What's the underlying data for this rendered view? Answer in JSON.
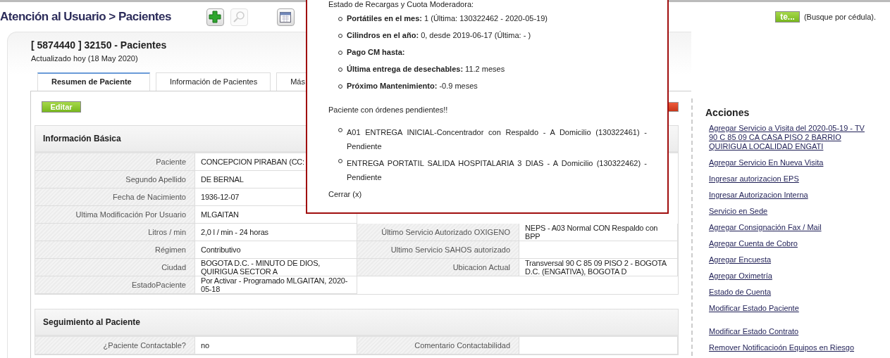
{
  "header": {
    "title": "Atención al Usuario > Pacientes",
    "toolbar": [
      {
        "kind": "add",
        "disabled": false
      },
      {
        "kind": "search",
        "disabled": true
      },
      {
        "kind": "calendar",
        "disabled": false
      }
    ],
    "search_button": "te...",
    "search_hint": "(Busque por cédula)."
  },
  "record": {
    "title": "[ 5874440 ] 32150 - Pacientes",
    "subtitle": "Actualizado hoy (18 May 2020)",
    "tabs": [
      {
        "label": "Resumen de Paciente",
        "selected": true
      },
      {
        "label": "Información de Pacientes",
        "selected": false
      },
      {
        "label": "Más",
        "selected": false
      }
    ],
    "edit_button": "Editar",
    "sections": [
      {
        "title": "Información Básica",
        "rows": [
          {
            "label": "Paciente",
            "value": "CONCEPCION PIRABAN (CC:"
          },
          {
            "label": "Segundo Apellido",
            "value": "DE BERNAL"
          },
          {
            "label": "Fecha de Nacimiento",
            "value": "1936-12-07"
          },
          {
            "label": "Ultima Modificación Por Usuario",
            "value": "MLGAITAN"
          },
          {
            "label": "Litros / min",
            "value": "2,0 l / min - 24 horas",
            "label_2": "Último Servicio Autorizado OXIGENO",
            "value_2": "NEPS - A03 Normal CON Respaldo con BPP"
          },
          {
            "label": "Régimen",
            "value": "Contributivo",
            "label_2": "Ultimo Servicio SAHOS autorizado"
          },
          {
            "label": "Ciudad",
            "value": "BOGOTA D.C. - MINUTO DE DIOS, QUIRIGUA SECTOR A",
            "label_2": "Ubicacion Actual",
            "value_2": "Transversal 90 C 85 09 PISO 2 - BOGOTA D.C. (ENGATIVA), BOGOTA D"
          },
          {
            "label": "EstadoPaciente",
            "value": "Por Activar - Programado MLGAITAN, 2020-05-18"
          }
        ]
      },
      {
        "title": "Seguimiento al Paciente",
        "rows": [
          {
            "label": "¿Paciente Contactable?",
            "value": "no",
            "label_2": "Comentario Contactabilidad"
          }
        ]
      }
    ]
  },
  "actions": {
    "title": "Acciones",
    "link_groups": [
      [
        {
          "label": "Agregar Servicio a Visita del 2020-05-19 - TV 90 C 85 09 CA CASA PISO 2 BARRIO QUIRIGUA LOCALIDAD ENGATI"
        },
        {
          "label": "Agregar Servicio En Nueva Visita"
        },
        {
          "label": "Ingresar autorizacion EPS"
        },
        {
          "label": "Ingresar Autorizacion Interna"
        },
        {
          "label": "Servicio en Sede"
        },
        {
          "label": "Agregar Consignación Fax / Mail"
        },
        {
          "label": "Agregar Cuenta de Cobro"
        },
        {
          "label": "Agregar Encuesta"
        },
        {
          "label": "Agregar Oximetría"
        },
        {
          "label": "Estado de Cuenta"
        },
        {
          "label": "Modificar Estado Paciente"
        }
      ],
      [
        {
          "label": "Modificar Estado Contrato"
        },
        {
          "label": "Remover Notificacioón Equipos en Riesgo"
        }
      ]
    ]
  },
  "popup": {
    "heading": "Estado de Recargas y Cuota Moderadora:",
    "stats": [
      "**Portátiles en el mes:** 1 (Última: 130322462 - 2020-05-19)",
      "**Cilindros en el año:** 0, desde 2019-06-17 (Última: - )",
      "**Pago CM hasta:**",
      "**Última entrega de desechables:** 11.2 meses",
      "**Próximo Mantenimiento:** -0.9 meses"
    ],
    "orders_heading": "Paciente con órdenes pendientes!!",
    "orders": [
      "A01 ENTREGA INICIAL-Concentrador con Respaldo - A Domicilio (130322461) - Pendiente",
      "ENTREGA PORTATIL SALIDA HOSPITALARIA 3 DIAS - A Domicilio (130322462) - Pendiente"
    ],
    "close": "Cerrar (x)"
  }
}
